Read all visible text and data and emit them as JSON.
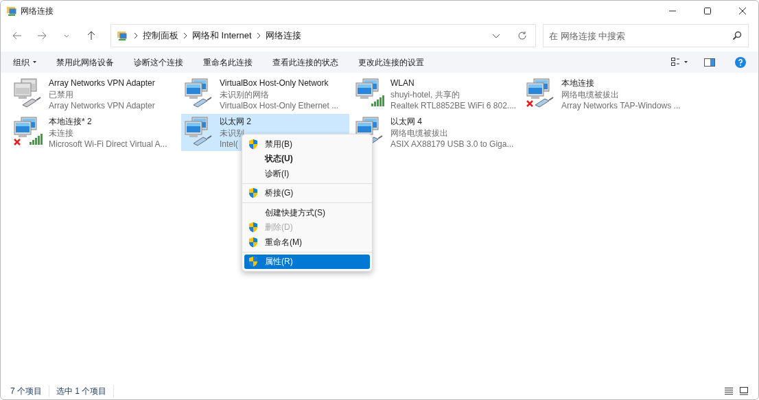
{
  "window": {
    "title": "网络连接"
  },
  "address_bar": {
    "breadcrumbs": [
      "控制面板",
      "网络和 Internet",
      "网络连接"
    ]
  },
  "search": {
    "placeholder": "在 网络连接 中搜索"
  },
  "toolbar": {
    "commands": [
      {
        "label": "组织",
        "dropdown": true
      },
      {
        "label": "禁用此网络设备",
        "dropdown": false
      },
      {
        "label": "诊断这个连接",
        "dropdown": false
      },
      {
        "label": "重命名此连接",
        "dropdown": false
      },
      {
        "label": "查看此连接的状态",
        "dropdown": false
      },
      {
        "label": "更改此连接的设置",
        "dropdown": false
      }
    ]
  },
  "connections": [
    {
      "name": "Array Networks VPN Adapter",
      "status": "已禁用",
      "device": "Array Networks VPN Adapter",
      "kind": "ethernet",
      "disabled": true,
      "disconnected": false,
      "selected": false
    },
    {
      "name": "VirtualBox Host-Only Network",
      "status": "未识别的网络",
      "device": "VirtualBox Host-Only Ethernet ...",
      "kind": "ethernet",
      "disabled": false,
      "disconnected": false,
      "selected": false
    },
    {
      "name": "WLAN",
      "status": "shuyi-hotel, 共享的",
      "device": "Realtek RTL8852BE WiFi 6 802....",
      "kind": "wifi",
      "disabled": false,
      "disconnected": false,
      "selected": false
    },
    {
      "name": "本地连接",
      "status": "网络电缆被拔出",
      "device": "Array Networks TAP-Windows ...",
      "kind": "ethernet",
      "disabled": false,
      "disconnected": true,
      "selected": false
    },
    {
      "name": "本地连接* 2",
      "status": "未连接",
      "device": "Microsoft Wi-Fi Direct Virtual A...",
      "kind": "wifi",
      "disabled": false,
      "disconnected": true,
      "selected": false
    },
    {
      "name": "以太网 2",
      "status": "未识别",
      "device": "Intel(",
      "kind": "ethernet",
      "disabled": false,
      "disconnected": false,
      "selected": true
    },
    {
      "name": "以太网 4",
      "status": "网络电缆被拔出",
      "device": "ASIX AX88179 USB 3.0 to Giga...",
      "kind": "ethernet",
      "disabled": false,
      "selected": false
    }
  ],
  "context_menu": [
    {
      "kind": "item",
      "label": "禁用(B)",
      "shield": true,
      "bold": false,
      "disabled": false,
      "selected": false
    },
    {
      "kind": "item",
      "label": "状态(U)",
      "shield": false,
      "bold": true,
      "disabled": false,
      "selected": false
    },
    {
      "kind": "item",
      "label": "诊断(I)",
      "shield": false,
      "bold": false,
      "disabled": false,
      "selected": false
    },
    {
      "kind": "separator"
    },
    {
      "kind": "item",
      "label": "桥接(G)",
      "shield": true,
      "bold": false,
      "disabled": false,
      "selected": false
    },
    {
      "kind": "separator"
    },
    {
      "kind": "item",
      "label": "创建快捷方式(S)",
      "shield": false,
      "bold": false,
      "disabled": false,
      "selected": false
    },
    {
      "kind": "item",
      "label": "删除(D)",
      "shield": true,
      "bold": false,
      "disabled": true,
      "selected": false
    },
    {
      "kind": "item",
      "label": "重命名(M)",
      "shield": true,
      "bold": false,
      "disabled": false,
      "selected": false
    },
    {
      "kind": "separator"
    },
    {
      "kind": "item",
      "label": "属性(R)",
      "shield": true,
      "bold": false,
      "disabled": false,
      "selected": true
    }
  ],
  "status_bar": {
    "item_count": "7 个项目",
    "selection": "选中 1 个项目"
  }
}
